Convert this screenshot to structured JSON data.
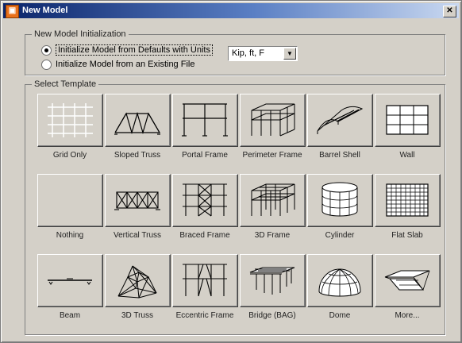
{
  "window": {
    "title": "New Model",
    "app_icon": "SAP"
  },
  "init_group": {
    "label": "New Model Initialization",
    "radio_defaults": "Initialize Model from Defaults with Units",
    "radio_existing": "Initialize Model from an Existing File",
    "units_value": "Kip, ft, F"
  },
  "template_group": {
    "label": "Select Template",
    "templates": [
      {
        "label": "Grid Only",
        "icon": "grid-icon"
      },
      {
        "label": "Sloped Truss",
        "icon": "sloped-truss-icon"
      },
      {
        "label": "Portal Frame",
        "icon": "portal-frame-icon"
      },
      {
        "label": "Perimeter Frame",
        "icon": "perimeter-frame-icon"
      },
      {
        "label": "Barrel Shell",
        "icon": "barrel-shell-icon"
      },
      {
        "label": "Wall",
        "icon": "wall-icon"
      },
      {
        "label": "Nothing",
        "icon": "blank-icon"
      },
      {
        "label": "Vertical Truss",
        "icon": "vertical-truss-icon"
      },
      {
        "label": "Braced Frame",
        "icon": "braced-frame-icon"
      },
      {
        "label": "3D Frame",
        "icon": "3d-frame-icon"
      },
      {
        "label": "Cylinder",
        "icon": "cylinder-icon"
      },
      {
        "label": "Flat Slab",
        "icon": "flat-slab-icon"
      },
      {
        "label": "Beam",
        "icon": "beam-icon"
      },
      {
        "label": "3D Truss",
        "icon": "3d-truss-icon"
      },
      {
        "label": "Eccentric Frame",
        "icon": "eccentric-frame-icon"
      },
      {
        "label": "Bridge (BAG)",
        "icon": "bridge-icon"
      },
      {
        "label": "Dome",
        "icon": "dome-icon"
      },
      {
        "label": "More...",
        "icon": "more-icon"
      }
    ]
  }
}
